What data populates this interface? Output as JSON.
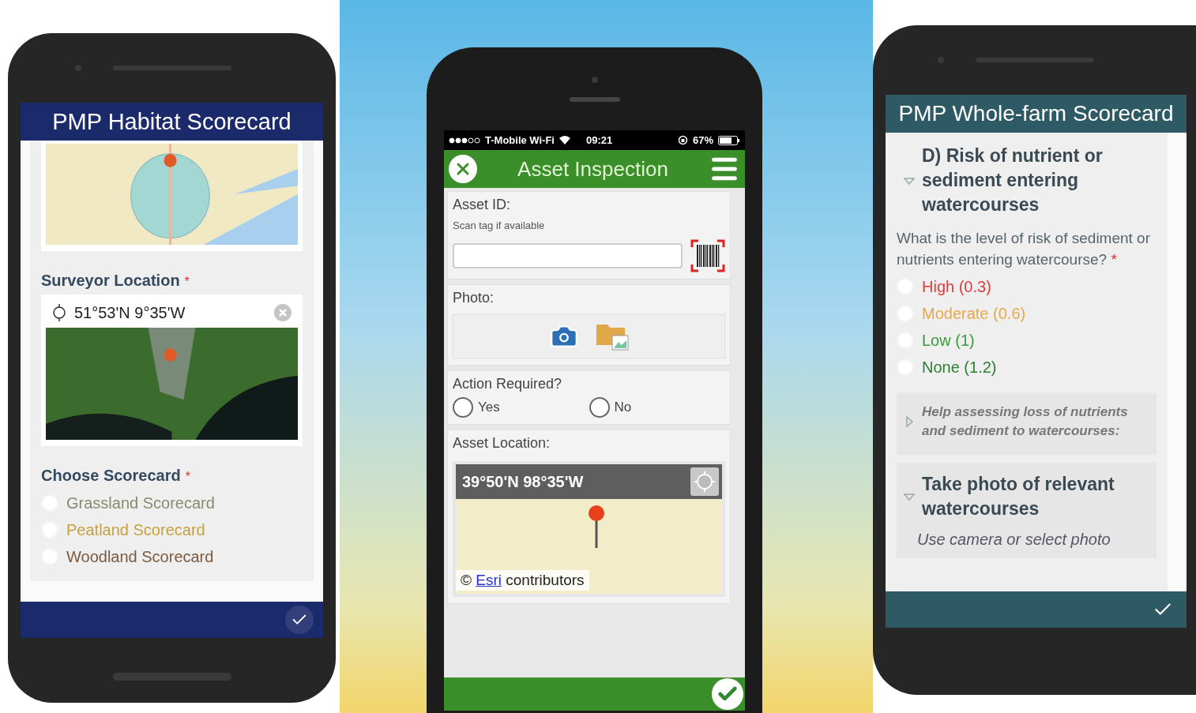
{
  "left_phone": {
    "title": "PMP Habitat Scorecard",
    "surveyor_location": {
      "label": "Surveyor Location",
      "required_mark": "*",
      "value": "51°53'N 9°35'W"
    },
    "choose_scorecard": {
      "label": "Choose Scorecard",
      "required_mark": "*",
      "options": [
        {
          "label": "Grassland Scorecard",
          "selected": false,
          "color": "#8a8a6e"
        },
        {
          "label": "Peatland Scorecard",
          "selected": false,
          "color": "#c8a040"
        },
        {
          "label": "Woodland Scorecard",
          "selected": false,
          "color": "#7a5a40"
        }
      ]
    }
  },
  "middle_phone": {
    "status_bar": {
      "carrier": "T-Mobile Wi-Fi",
      "time": "09:21",
      "battery": "67%"
    },
    "title": "Asset Inspection",
    "asset_id": {
      "label": "Asset ID:",
      "hint": "Scan tag if available"
    },
    "photo": {
      "label": "Photo:"
    },
    "action_required": {
      "label": "Action Required?",
      "options": [
        {
          "label": "Yes",
          "selected": false
        },
        {
          "label": "No",
          "selected": false
        }
      ]
    },
    "asset_location": {
      "label": "Asset Location:",
      "coordinates": "39°50'N 98°35'W",
      "attribution": {
        "symbol": "©",
        "link": "Esri",
        "text": "contributors"
      }
    }
  },
  "right_phone": {
    "title": "PMP Whole-farm Scorecard",
    "section": {
      "heading": "D) Risk of nutrient or sediment entering watercourses",
      "expanded": true,
      "question": "What is the level of risk of sediment or nutrients entering watercourse?",
      "required_mark": "*",
      "options": [
        {
          "label": "High (0.3)",
          "selected": false,
          "color": "#e03c3c"
        },
        {
          "label": "Moderate (0.6)",
          "selected": false,
          "color": "#e8a84a"
        },
        {
          "label": "Low (1)",
          "selected": false,
          "color": "#3a9a3a"
        },
        {
          "label": "None (1.2)",
          "selected": false,
          "color": "#2e7d32"
        }
      ]
    },
    "help": {
      "text": "Help assessing loss of nutrients and sediment to watercourses:",
      "expanded": false
    },
    "photo_group": {
      "heading": "Take photo of relevant watercourses",
      "expanded": true,
      "hint": "Use camera or select photo"
    }
  }
}
